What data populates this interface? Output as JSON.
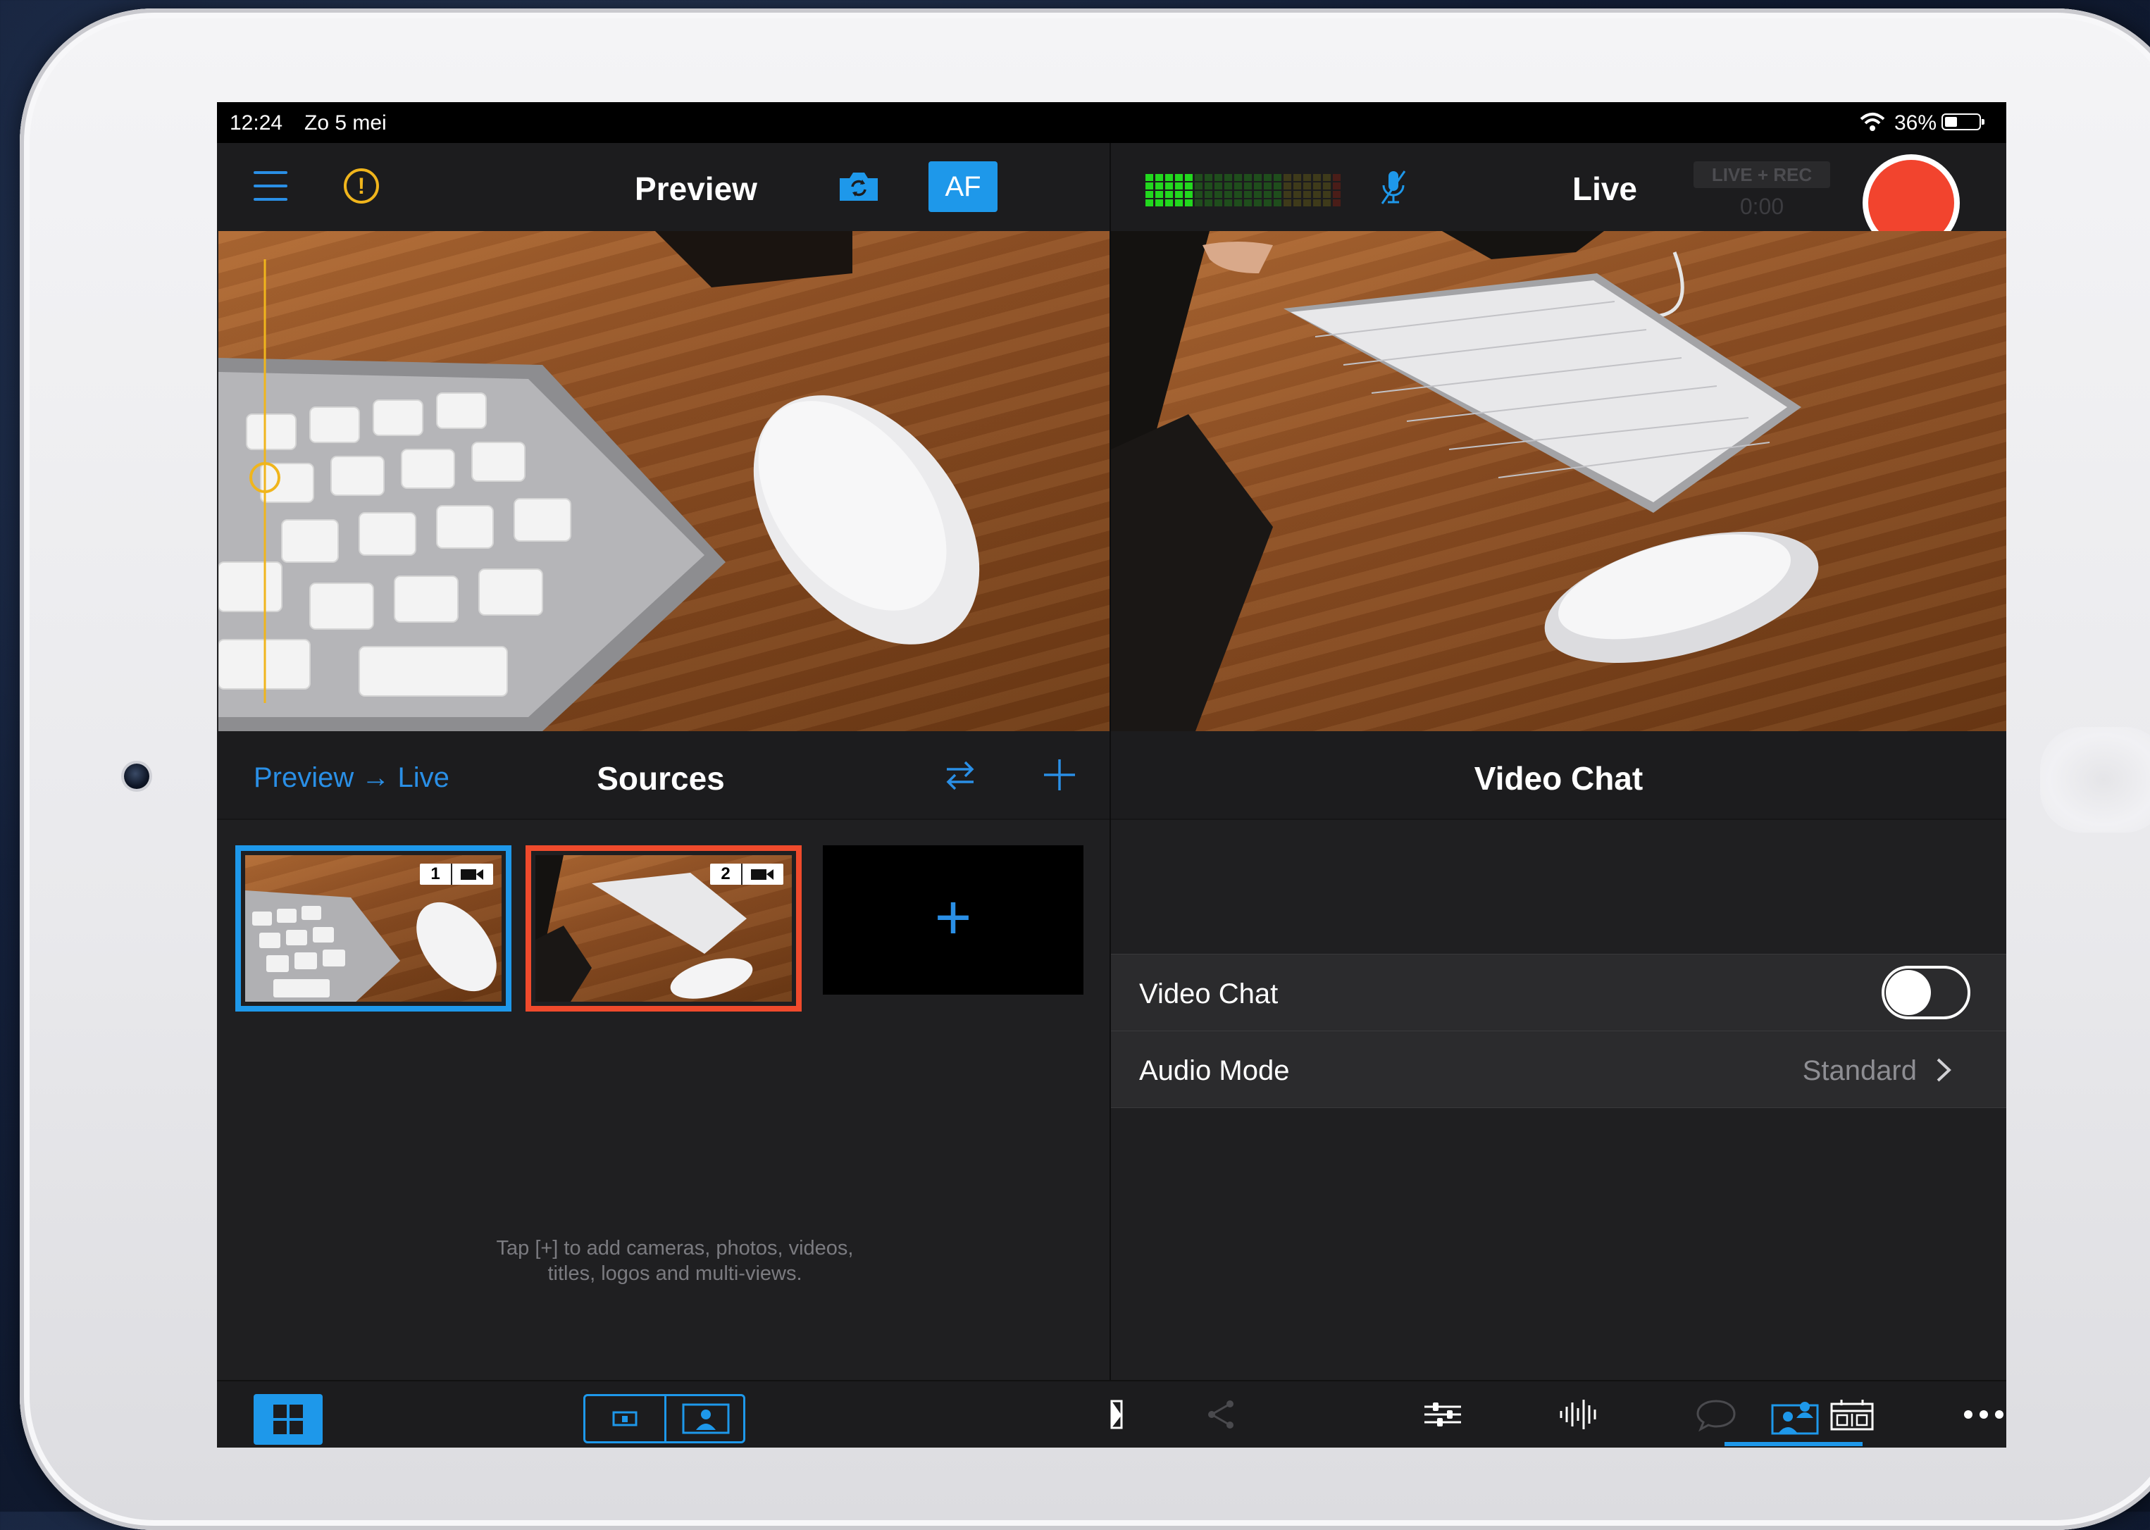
{
  "status_bar": {
    "time": "12:24",
    "date": "Zo 5 mei",
    "battery": "36%"
  },
  "preview_panel": {
    "title": "Preview",
    "af_label": "AF"
  },
  "live_panel": {
    "title": "Live",
    "badge": "LIVE + REC",
    "timer": "0:00"
  },
  "sources_panel": {
    "link": "Preview → Live",
    "title": "Sources",
    "sources": [
      {
        "number": "1"
      },
      {
        "number": "2"
      }
    ],
    "add_label": "+",
    "hint_line1": "Tap [+] to add cameras, photos, videos,",
    "hint_line2": "titles, logos and multi-views."
  },
  "video_chat_panel": {
    "title": "Video Chat",
    "rows": [
      {
        "label": "Video Chat",
        "toggle_on": false
      },
      {
        "label": "Audio Mode",
        "value": "Standard"
      }
    ]
  },
  "colors": {
    "accent": "#1e98ea",
    "record": "#f2442e",
    "warning": "#f0b51c",
    "live_border": "#ef4a2c"
  },
  "icons": [
    "menu-icon",
    "alert-icon",
    "camera-flip-icon",
    "mic-muted-icon",
    "swap-icon",
    "add-icon",
    "grid-icon",
    "share-icon",
    "mixer-icon",
    "audio-icon",
    "comment-icon",
    "scoreboard-icon",
    "video-chat-icon",
    "more-icon"
  ]
}
